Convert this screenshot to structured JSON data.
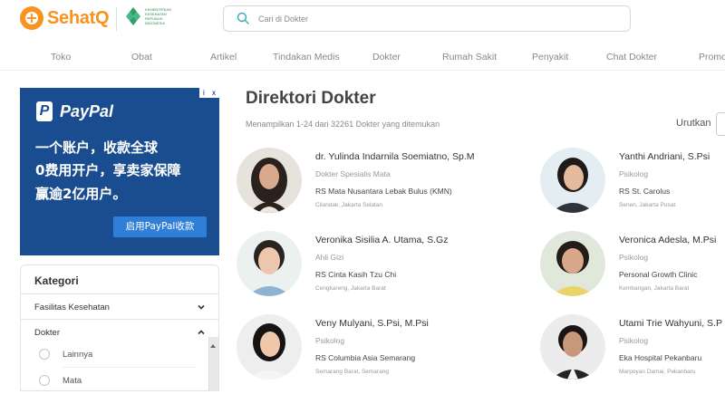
{
  "header": {
    "brand": "SehatQ",
    "partner_logo_text": "KEMENTERIAN KESEHATAN REPUBLIK INDONESIA",
    "search_placeholder": "Cari di Dokter"
  },
  "nav": {
    "items": [
      "Toko",
      "Obat",
      "Artikel",
      "Tindakan Medis",
      "Dokter",
      "Rumah Sakit",
      "Penyakit",
      "Chat Dokter",
      "Promo"
    ]
  },
  "ad": {
    "brand": "PayPal",
    "line1": "一个账户，收款全球",
    "line2": "0费用开户，享卖家保障",
    "line3": "赢逾2亿用户。",
    "cta": "启用PayPal收款",
    "close_icons": [
      "i",
      "x"
    ]
  },
  "sidebar": {
    "title": "Kategori",
    "rows": [
      {
        "label": "Fasilitas Kesehatan",
        "state": "collapsed"
      },
      {
        "label": "Dokter",
        "state": "expanded"
      }
    ],
    "sub_items": [
      "Lainnya",
      "Mata"
    ]
  },
  "main": {
    "title": "Direktori Dokter",
    "subtitle": "Menampilkan 1-24 dari 32261 Dokter yang ditemukan",
    "sort_label": "Urutkan"
  },
  "doctors": [
    {
      "name": "dr. Yulinda Indarnila Soemiatno, Sp.M",
      "specialty": "Dokter Spesialis Mata",
      "hospital": "RS Mata Nusantara Lebak Bulus (KMN)",
      "location": "Cilandak, Jakarta Selatan"
    },
    {
      "name": "Yanthi Andriani, S.Psi",
      "specialty": "Psikolog",
      "hospital": "RS St. Carolus",
      "location": "Senen, Jakarta Pusat"
    },
    {
      "name": "Veronika Sisilia A. Utama, S.Gz",
      "specialty": "Ahli Gizi",
      "hospital": "RS Cinta Kasih Tzu Chi",
      "location": "Cengkareng, Jakarta Barat"
    },
    {
      "name": "Veronica Adesla, M.Psi",
      "specialty": "Psikolog",
      "hospital": "Personal Growth Clinic",
      "location": "Kembangan, Jakarta Barat"
    },
    {
      "name": "Veny Mulyani, S.Psi, M.Psi",
      "specialty": "Psikolog",
      "hospital": "RS Columbia Asia Semarang",
      "location": "Semarang Barat, Semarang"
    },
    {
      "name": "Utami Trie Wahyuni, S.P",
      "specialty": "Psikolog",
      "hospital": "Eka Hospital Pekanbaru",
      "location": "Marpoyan Damai, Pekanbaru"
    }
  ],
  "colors": {
    "brand_orange": "#f7931e",
    "ad_blue": "#1a4d8f",
    "ad_button": "#2f7fd8"
  }
}
